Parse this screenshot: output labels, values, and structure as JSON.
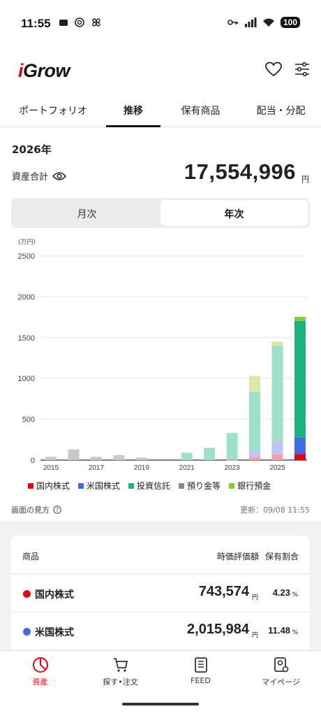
{
  "status": {
    "time": "11:55",
    "battery": "100"
  },
  "app": {
    "logo_text": "Grow",
    "logo_i": "i"
  },
  "tabs": [
    "ポートフォリオ",
    "推移",
    "保有商品",
    "配当・分配"
  ],
  "summary": {
    "year": "2026年",
    "asset_label": "資産合計",
    "total": "17,554,996",
    "unit": "円"
  },
  "segment": {
    "monthly": "月次",
    "yearly": "年次"
  },
  "chart_data": {
    "type": "bar",
    "stacked": true,
    "unit_label": "(万円)",
    "ylim": [
      0,
      2500
    ],
    "yticks": [
      "2500",
      "2000",
      "1500",
      "1000",
      "500",
      "0"
    ],
    "x_tick_labels": [
      "2015",
      "2017",
      "2019",
      "2021",
      "2023",
      "2025"
    ],
    "categories": [
      "2015",
      "2016",
      "2017",
      "2018",
      "2019",
      "2020",
      "2021",
      "2022",
      "2023",
      "2024",
      "2025",
      "2026"
    ],
    "series": [
      {
        "name": "国内株式",
        "color": "#e60012",
        "values": [
          0,
          0,
          0,
          0,
          0,
          0,
          0,
          0,
          2,
          40,
          70,
          74
        ]
      },
      {
        "name": "米国株式",
        "color": "#4169e1",
        "values": [
          0,
          0,
          0,
          0,
          0,
          0,
          0,
          0,
          20,
          80,
          160,
          202
        ]
      },
      {
        "name": "投資信託",
        "color": "#1db37e",
        "values": [
          0,
          0,
          0,
          0,
          0,
          0,
          90,
          150,
          310,
          710,
          1170,
          1430
        ]
      },
      {
        "name": "預り金等",
        "color": "#888888",
        "values": [
          40,
          130,
          40,
          60,
          30,
          0,
          0,
          0,
          0,
          0,
          0,
          0
        ]
      },
      {
        "name": "銀行預金",
        "color": "#8cc63f",
        "values": [
          0,
          0,
          0,
          0,
          0,
          0,
          0,
          0,
          0,
          200,
          50,
          48
        ]
      }
    ]
  },
  "legend": [
    {
      "label": "国内株式",
      "color": "#e60012"
    },
    {
      "label": "米国株式",
      "color": "#4169e1"
    },
    {
      "label": "投資信託",
      "color": "#1db37e"
    },
    {
      "label": "預り金等",
      "color": "#888888"
    },
    {
      "label": "銀行預金",
      "color": "#8cc63f"
    }
  ],
  "footer": {
    "howto": "画面の見方",
    "updated": "更新：09/08 11:55"
  },
  "holdings": {
    "headers": {
      "name": "商品",
      "value": "時価評価額",
      "share": "保有割合"
    },
    "rows": [
      {
        "name": "国内株式",
        "color": "#e60012",
        "value": "743,574",
        "yen": "円",
        "share": "4.23",
        "pct": "%"
      },
      {
        "name": "米国株式",
        "color": "#4169e1",
        "value": "2,015,984",
        "yen": "円",
        "share": "11.48",
        "pct": "%"
      }
    ]
  },
  "nav": [
    {
      "label": "資産",
      "icon": "pie-chart-icon"
    },
    {
      "label": "探す•注文",
      "icon": "cart-icon"
    },
    {
      "label": "FEED",
      "icon": "document-icon"
    },
    {
      "label": "マイページ",
      "icon": "profile-icon"
    }
  ]
}
